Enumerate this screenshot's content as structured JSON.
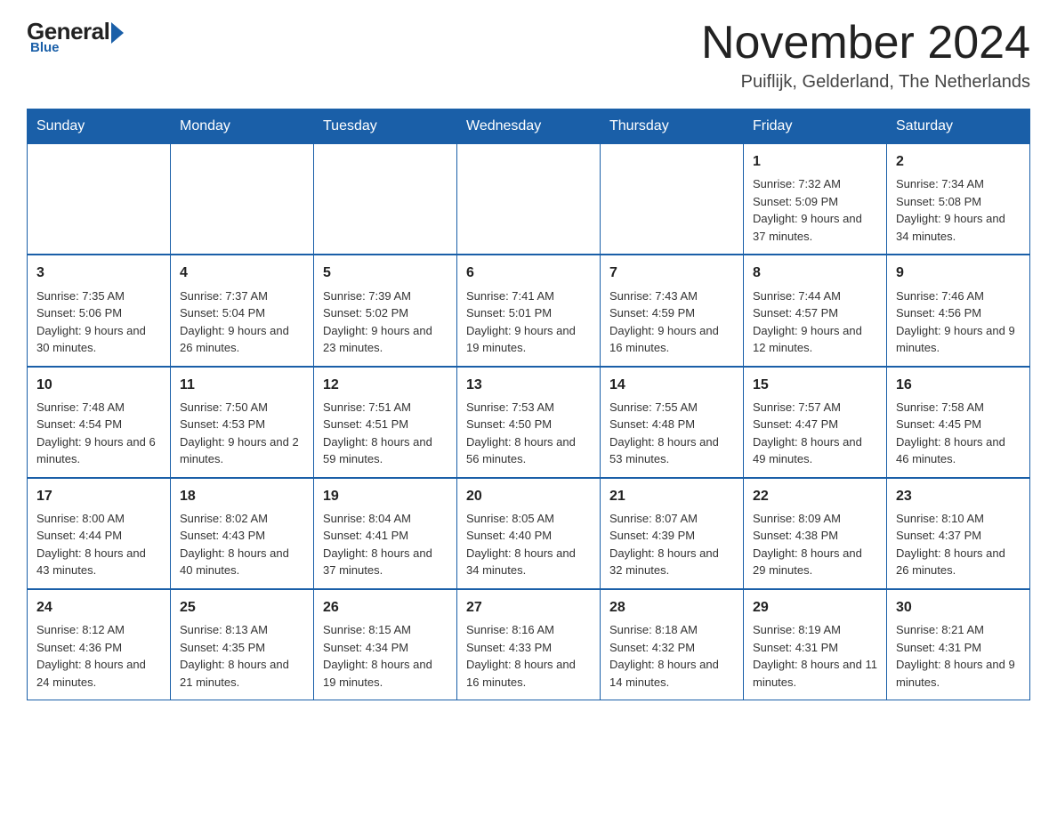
{
  "header": {
    "logo": {
      "general": "General",
      "blue": "Blue",
      "tagline": "Blue"
    },
    "title": "November 2024",
    "location": "Puiflijk, Gelderland, The Netherlands"
  },
  "weekdays": [
    "Sunday",
    "Monday",
    "Tuesday",
    "Wednesday",
    "Thursday",
    "Friday",
    "Saturday"
  ],
  "weeks": [
    [
      {
        "day": "",
        "info": ""
      },
      {
        "day": "",
        "info": ""
      },
      {
        "day": "",
        "info": ""
      },
      {
        "day": "",
        "info": ""
      },
      {
        "day": "",
        "info": ""
      },
      {
        "day": "1",
        "info": "Sunrise: 7:32 AM\nSunset: 5:09 PM\nDaylight: 9 hours and 37 minutes."
      },
      {
        "day": "2",
        "info": "Sunrise: 7:34 AM\nSunset: 5:08 PM\nDaylight: 9 hours and 34 minutes."
      }
    ],
    [
      {
        "day": "3",
        "info": "Sunrise: 7:35 AM\nSunset: 5:06 PM\nDaylight: 9 hours and 30 minutes."
      },
      {
        "day": "4",
        "info": "Sunrise: 7:37 AM\nSunset: 5:04 PM\nDaylight: 9 hours and 26 minutes."
      },
      {
        "day": "5",
        "info": "Sunrise: 7:39 AM\nSunset: 5:02 PM\nDaylight: 9 hours and 23 minutes."
      },
      {
        "day": "6",
        "info": "Sunrise: 7:41 AM\nSunset: 5:01 PM\nDaylight: 9 hours and 19 minutes."
      },
      {
        "day": "7",
        "info": "Sunrise: 7:43 AM\nSunset: 4:59 PM\nDaylight: 9 hours and 16 minutes."
      },
      {
        "day": "8",
        "info": "Sunrise: 7:44 AM\nSunset: 4:57 PM\nDaylight: 9 hours and 12 minutes."
      },
      {
        "day": "9",
        "info": "Sunrise: 7:46 AM\nSunset: 4:56 PM\nDaylight: 9 hours and 9 minutes."
      }
    ],
    [
      {
        "day": "10",
        "info": "Sunrise: 7:48 AM\nSunset: 4:54 PM\nDaylight: 9 hours and 6 minutes."
      },
      {
        "day": "11",
        "info": "Sunrise: 7:50 AM\nSunset: 4:53 PM\nDaylight: 9 hours and 2 minutes."
      },
      {
        "day": "12",
        "info": "Sunrise: 7:51 AM\nSunset: 4:51 PM\nDaylight: 8 hours and 59 minutes."
      },
      {
        "day": "13",
        "info": "Sunrise: 7:53 AM\nSunset: 4:50 PM\nDaylight: 8 hours and 56 minutes."
      },
      {
        "day": "14",
        "info": "Sunrise: 7:55 AM\nSunset: 4:48 PM\nDaylight: 8 hours and 53 minutes."
      },
      {
        "day": "15",
        "info": "Sunrise: 7:57 AM\nSunset: 4:47 PM\nDaylight: 8 hours and 49 minutes."
      },
      {
        "day": "16",
        "info": "Sunrise: 7:58 AM\nSunset: 4:45 PM\nDaylight: 8 hours and 46 minutes."
      }
    ],
    [
      {
        "day": "17",
        "info": "Sunrise: 8:00 AM\nSunset: 4:44 PM\nDaylight: 8 hours and 43 minutes."
      },
      {
        "day": "18",
        "info": "Sunrise: 8:02 AM\nSunset: 4:43 PM\nDaylight: 8 hours and 40 minutes."
      },
      {
        "day": "19",
        "info": "Sunrise: 8:04 AM\nSunset: 4:41 PM\nDaylight: 8 hours and 37 minutes."
      },
      {
        "day": "20",
        "info": "Sunrise: 8:05 AM\nSunset: 4:40 PM\nDaylight: 8 hours and 34 minutes."
      },
      {
        "day": "21",
        "info": "Sunrise: 8:07 AM\nSunset: 4:39 PM\nDaylight: 8 hours and 32 minutes."
      },
      {
        "day": "22",
        "info": "Sunrise: 8:09 AM\nSunset: 4:38 PM\nDaylight: 8 hours and 29 minutes."
      },
      {
        "day": "23",
        "info": "Sunrise: 8:10 AM\nSunset: 4:37 PM\nDaylight: 8 hours and 26 minutes."
      }
    ],
    [
      {
        "day": "24",
        "info": "Sunrise: 8:12 AM\nSunset: 4:36 PM\nDaylight: 8 hours and 24 minutes."
      },
      {
        "day": "25",
        "info": "Sunrise: 8:13 AM\nSunset: 4:35 PM\nDaylight: 8 hours and 21 minutes."
      },
      {
        "day": "26",
        "info": "Sunrise: 8:15 AM\nSunset: 4:34 PM\nDaylight: 8 hours and 19 minutes."
      },
      {
        "day": "27",
        "info": "Sunrise: 8:16 AM\nSunset: 4:33 PM\nDaylight: 8 hours and 16 minutes."
      },
      {
        "day": "28",
        "info": "Sunrise: 8:18 AM\nSunset: 4:32 PM\nDaylight: 8 hours and 14 minutes."
      },
      {
        "day": "29",
        "info": "Sunrise: 8:19 AM\nSunset: 4:31 PM\nDaylight: 8 hours and 11 minutes."
      },
      {
        "day": "30",
        "info": "Sunrise: 8:21 AM\nSunset: 4:31 PM\nDaylight: 8 hours and 9 minutes."
      }
    ]
  ]
}
